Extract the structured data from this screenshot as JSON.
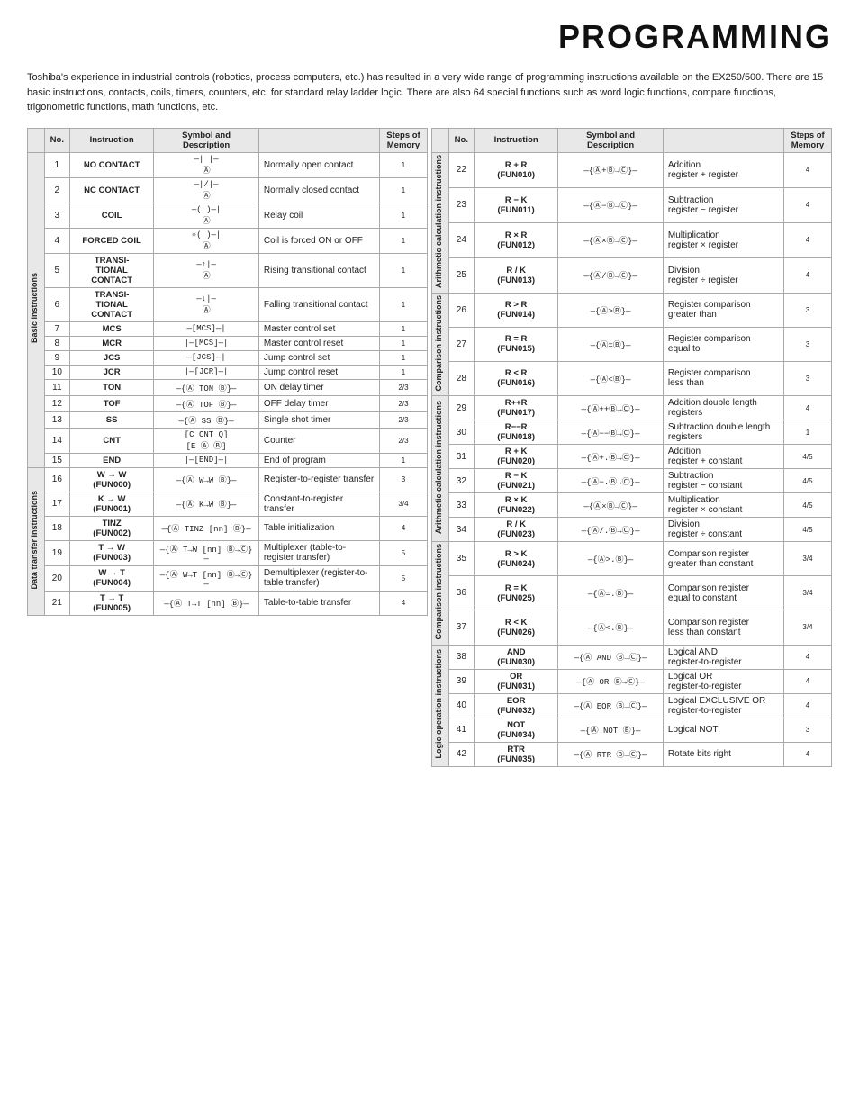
{
  "title": "PROGRAMMING",
  "intro": "Toshiba's experience in industrial controls (robotics, process computers, etc.) has resulted in a very wide range of programming instructions available on the EX250/500. There are 15 basic instructions, contacts, coils, timers, counters, etc. for standard relay ladder logic. There are also 64 special functions such as word logic functions, compare functions, trigonometric functions, math functions, etc.",
  "left_headers": {
    "no": "No.",
    "instr": "Instruction",
    "sym_desc": "Symbol and Description",
    "steps": "Steps of Memory"
  },
  "right_headers": {
    "no": "No.",
    "instr": "Instruction",
    "sym_desc": "Symbol and Description",
    "steps": "Steps of Memory"
  },
  "left_rows": [
    {
      "no": 1,
      "instr": "NO CONTACT",
      "symbol": "—| |—\n  Ⓐ",
      "desc": "Normally open contact",
      "steps": "1",
      "cat": "Basic instructions"
    },
    {
      "no": 2,
      "instr": "NC CONTACT",
      "symbol": "—|/|—\n  Ⓐ",
      "desc": "Normally closed contact",
      "steps": "1",
      "cat": "Basic instructions"
    },
    {
      "no": 3,
      "instr": "COIL",
      "symbol": "—( )—|\n  Ⓐ",
      "desc": "Relay coil",
      "steps": "1",
      "cat": "Basic instructions"
    },
    {
      "no": 4,
      "instr": "FORCED COIL",
      "symbol": "✳( )—|\n   Ⓐ",
      "desc": "Coil is forced ON or OFF",
      "steps": "1",
      "cat": "Basic instructions"
    },
    {
      "no": 5,
      "instr": "TRANSI-\nTIONAL\nCONTACT",
      "symbol": "—↑|—\n  Ⓐ",
      "desc": "Rising transitional contact",
      "steps": "1",
      "cat": "Basic instructions"
    },
    {
      "no": 6,
      "instr": "TRANSI-\nTIONAL\nCONTACT",
      "symbol": "—↓|—\n  Ⓐ",
      "desc": "Falling transitional contact",
      "steps": "1",
      "cat": "Basic instructions"
    },
    {
      "no": 7,
      "instr": "MCS",
      "symbol": "—[MCS]—|",
      "desc": "Master control set",
      "steps": "1",
      "cat": "Basic instructions"
    },
    {
      "no": 8,
      "instr": "MCR",
      "symbol": "|—[MCS]—|",
      "desc": "Master control reset",
      "steps": "1",
      "cat": "Basic instructions"
    },
    {
      "no": 9,
      "instr": "JCS",
      "symbol": "—[JCS]—|",
      "desc": "Jump control set",
      "steps": "1",
      "cat": "Basic instructions"
    },
    {
      "no": 10,
      "instr": "JCR",
      "symbol": "|—[JCR]—|",
      "desc": "Jump control reset",
      "steps": "1",
      "cat": "Basic instructions"
    },
    {
      "no": 11,
      "instr": "TON",
      "symbol": "—{Ⓐ TON Ⓑ}—",
      "desc": "ON delay timer",
      "steps": "2/3",
      "cat": "Basic instructions"
    },
    {
      "no": 12,
      "instr": "TOF",
      "symbol": "—{Ⓐ TOF Ⓑ}—",
      "desc": "OFF delay timer",
      "steps": "2/3",
      "cat": "Basic instructions"
    },
    {
      "no": 13,
      "instr": "SS",
      "symbol": "—{Ⓐ SS Ⓑ}—",
      "desc": "Single shot timer",
      "steps": "2/3",
      "cat": "Basic instructions"
    },
    {
      "no": 14,
      "instr": "CNT",
      "symbol": "[C CNT Q]\n[E Ⓐ  Ⓑ]",
      "desc": "Counter",
      "steps": "2/3",
      "cat": "Basic instructions"
    },
    {
      "no": 15,
      "instr": "END",
      "symbol": "|—[END]—|",
      "desc": "End of program",
      "steps": "1",
      "cat": "Basic instructions"
    },
    {
      "no": 16,
      "instr": "W → W\n(FUN000)",
      "symbol": "—{Ⓐ W→W Ⓑ}—",
      "desc": "Register-to-register transfer",
      "steps": "3",
      "cat": "Data transfer instructions"
    },
    {
      "no": 17,
      "instr": "K → W\n(FUN001)",
      "symbol": "—{Ⓐ K→W Ⓑ}—",
      "desc": "Constant-to-register transfer",
      "steps": "3/4",
      "cat": "Data transfer instructions"
    },
    {
      "no": 18,
      "instr": "TINZ\n(FUN002)",
      "symbol": "—{Ⓐ TINZ [nn] Ⓑ}—",
      "desc": "Table initialization",
      "steps": "4",
      "cat": "Data transfer instructions"
    },
    {
      "no": 19,
      "instr": "T → W\n(FUN003)",
      "symbol": "—{Ⓐ T→W [nn] Ⓑ→Ⓒ}—",
      "desc": "Multiplexer (table-to-register transfer)",
      "steps": "5",
      "cat": "Data transfer instructions"
    },
    {
      "no": 20,
      "instr": "W → T\n(FUN004)",
      "symbol": "—{Ⓐ W→T [nn] Ⓑ→Ⓒ}—",
      "desc": "Demultiplexer (register-to-table transfer)",
      "steps": "5",
      "cat": "Data transfer instructions"
    },
    {
      "no": 21,
      "instr": "T → T\n(FUN005)",
      "symbol": "—{Ⓐ T→T [nn] Ⓑ}—",
      "desc": "Table-to-table transfer",
      "steps": "4",
      "cat": "Data transfer instructions"
    }
  ],
  "right_rows": [
    {
      "no": 22,
      "instr": "R + R\n(FUN010)",
      "symbol": "—{Ⓐ+Ⓑ→Ⓒ}—",
      "desc": "Addition\nregister + register",
      "steps": "4",
      "cat": "Arithmetic calculation instructions"
    },
    {
      "no": 23,
      "instr": "R − K\n(FUN011)",
      "symbol": "—{Ⓐ−Ⓑ→Ⓒ}—",
      "desc": "Subtraction\nregister − register",
      "steps": "4",
      "cat": "Arithmetic calculation instructions"
    },
    {
      "no": 24,
      "instr": "R × R\n(FUN012)",
      "symbol": "—{Ⓐ×Ⓑ→Ⓒ}—",
      "desc": "Multiplication\nregister × register",
      "steps": "4",
      "cat": "Arithmetic calculation instructions"
    },
    {
      "no": 25,
      "instr": "R / K\n(FUN013)",
      "symbol": "—{Ⓐ/Ⓑ→Ⓒ}—",
      "desc": "Division\nregister ÷ register",
      "steps": "4",
      "cat": "Arithmetic calculation instructions"
    },
    {
      "no": 26,
      "instr": "R > R\n(FUN014)",
      "symbol": "—{Ⓐ>Ⓑ}—",
      "desc": "Register comparison\ngreater than",
      "steps": "3",
      "cat": "Comparison instructions"
    },
    {
      "no": 27,
      "instr": "R = R\n(FUN015)",
      "symbol": "—{Ⓐ=Ⓑ}—",
      "desc": "Register comparison\nequal to",
      "steps": "3",
      "cat": "Comparison instructions"
    },
    {
      "no": 28,
      "instr": "R < R\n(FUN016)",
      "symbol": "—{Ⓐ<Ⓑ}—",
      "desc": "Register comparison\nless than",
      "steps": "3",
      "cat": "Comparison instructions"
    },
    {
      "no": 29,
      "instr": "R++R\n(FUN017)",
      "symbol": "—{Ⓐ++Ⓑ→Ⓒ}—",
      "desc": "Addition double length registers",
      "steps": "4",
      "cat": "Arithmetic calculation instructions"
    },
    {
      "no": 30,
      "instr": "R−−R\n(FUN018)",
      "symbol": "—{Ⓐ−−Ⓑ→Ⓒ}—",
      "desc": "Subtraction double length registers",
      "steps": "1",
      "cat": "Arithmetic calculation instructions"
    },
    {
      "no": 31,
      "instr": "R + K\n(FUN020)",
      "symbol": "—{Ⓐ+.Ⓑ→Ⓒ}—",
      "desc": "Addition\nregister + constant",
      "steps": "4/5",
      "cat": "Arithmetic calculation instructions"
    },
    {
      "no": 32,
      "instr": "R − K\n(FUN021)",
      "symbol": "—{Ⓐ−.Ⓑ→Ⓒ}—",
      "desc": "Subtraction\nregister − constant",
      "steps": "4/5",
      "cat": "Arithmetic calculation instructions"
    },
    {
      "no": 33,
      "instr": "R × K\n(FUN022)",
      "symbol": "—{Ⓐ×Ⓑ→Ⓒ}—",
      "desc": "Multiplication\nregister × constant",
      "steps": "4/5",
      "cat": "Arithmetic calculation instructions"
    },
    {
      "no": 34,
      "instr": "R / K\n(FUN023)",
      "symbol": "—{Ⓐ/.Ⓑ→Ⓒ}—",
      "desc": "Division\nregister ÷ constant",
      "steps": "4/5",
      "cat": "Arithmetic calculation instructions"
    },
    {
      "no": 35,
      "instr": "R > K\n(FUN024)",
      "symbol": "—{Ⓐ>.Ⓑ}—",
      "desc": "Comparison register\ngreater than constant",
      "steps": "3/4",
      "cat": "Comparison instructions"
    },
    {
      "no": 36,
      "instr": "R = K\n(FUN025)",
      "symbol": "—{Ⓐ=.Ⓑ}—",
      "desc": "Comparison register\nequal to constant",
      "steps": "3/4",
      "cat": "Comparison instructions"
    },
    {
      "no": 37,
      "instr": "R < K\n(FUN026)",
      "symbol": "—{Ⓐ<.Ⓑ}—",
      "desc": "Comparison register\nless than constant",
      "steps": "3/4",
      "cat": "Comparison instructions"
    },
    {
      "no": 38,
      "instr": "AND\n(FUN030)",
      "symbol": "—{Ⓐ AND Ⓑ→Ⓒ}—",
      "desc": "Logical AND\nregister-to-register",
      "steps": "4",
      "cat": "Logic operation instructions"
    },
    {
      "no": 39,
      "instr": "OR\n(FUN031)",
      "symbol": "—{Ⓐ OR Ⓑ→Ⓒ}—",
      "desc": "Logical OR\nregister-to-register",
      "steps": "4",
      "cat": "Logic operation instructions"
    },
    {
      "no": 40,
      "instr": "EOR\n(FUN032)",
      "symbol": "—{Ⓐ EOR Ⓑ→Ⓒ}—",
      "desc": "Logical EXCLUSIVE OR register-to-register",
      "steps": "4",
      "cat": "Logic operation instructions"
    },
    {
      "no": 41,
      "instr": "NOT\n(FUN034)",
      "symbol": "—{Ⓐ NOT Ⓑ}—",
      "desc": "Logical NOT",
      "steps": "3",
      "cat": "Logic operation instructions"
    },
    {
      "no": 42,
      "instr": "RTR\n(FUN035)",
      "symbol": "—{Ⓐ RTR Ⓑ→Ⓒ}—",
      "desc": "Rotate bits right",
      "steps": "4",
      "cat": "Logic operation instructions"
    }
  ]
}
